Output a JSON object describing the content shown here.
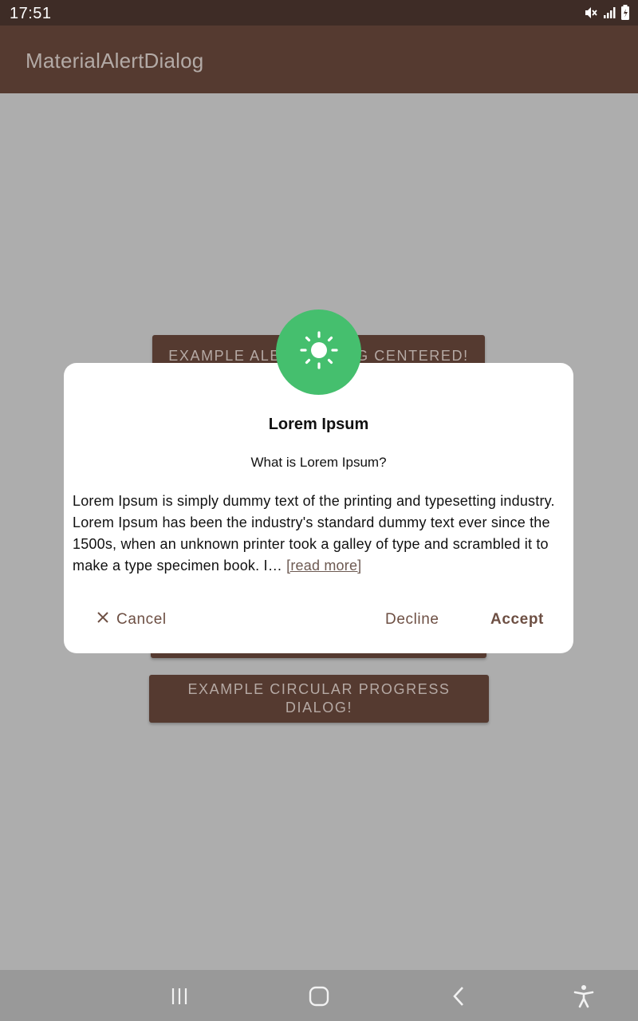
{
  "status_bar": {
    "time": "17:51"
  },
  "app_bar": {
    "title": "MaterialAlertDialog"
  },
  "background_buttons": [
    {
      "label": "EXAMPLE ALERT DIALOG CENTERED!"
    },
    {
      "label": ""
    },
    {
      "label": "EXAMPLE CIRCULAR PROGRESS DIALOG!"
    }
  ],
  "dialog": {
    "icon": "sun-icon",
    "title": "Lorem Ipsum",
    "subtitle": "What is Lorem Ipsum?",
    "message": "Lorem Ipsum is simply dummy text of the printing and typesetting industry. Lorem Ipsum has been the industry's standard dummy text ever since the 1500s, when an unknown printer took a galley of type and scrambled it to make a type specimen book. I… ",
    "read_more": "[read more]",
    "actions": {
      "cancel": "Cancel",
      "decline": "Decline",
      "accept": "Accept"
    },
    "accent_color": "#45BF6E"
  },
  "nav_bar": {
    "buttons": [
      "recent-apps-icon",
      "home-icon",
      "back-icon",
      "accessibility-icon"
    ]
  },
  "colors": {
    "primary": "#553A30",
    "primary_dark": "#3E2C26",
    "scrim": "#ADADAD"
  }
}
